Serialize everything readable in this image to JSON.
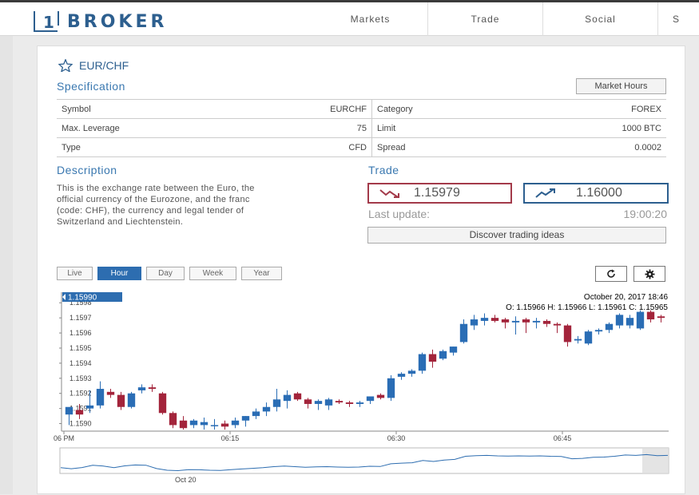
{
  "brand": {
    "logo_mark": "1",
    "name": "BROKER"
  },
  "nav": {
    "items": [
      "Markets",
      "Trade",
      "Social",
      "S"
    ]
  },
  "instrument": {
    "title": "EUR/CHF",
    "star_icon": "star-icon"
  },
  "specification": {
    "heading": "Specification",
    "market_hours_label": "Market Hours",
    "rows": [
      {
        "k1": "Symbol",
        "v1": "EURCHF",
        "k2": "Category",
        "v2": "FOREX"
      },
      {
        "k1": "Max. Leverage",
        "v1": "75",
        "k2": "Limit",
        "v2": "1000 BTC"
      },
      {
        "k1": "Type",
        "v1": "CFD",
        "k2": "Spread",
        "v2": "0.0002"
      }
    ]
  },
  "description": {
    "heading": "Description",
    "lines": [
      "This is the exchange rate between the Euro, the",
      "official currency of the Eurozone, and the franc",
      "(code: CHF), the currency and legal tender of",
      "Switzerland and Liechtenstein."
    ]
  },
  "trade": {
    "heading": "Trade",
    "sell_price": "1.15979",
    "buy_price": "1.16000",
    "last_update_label": "Last update:",
    "last_update_time": "19:00:20",
    "discover_label": "Discover trading ideas"
  },
  "chart_controls": {
    "tabs": [
      "Live",
      "Hour",
      "Day",
      "Week",
      "Year"
    ],
    "active_tab": "Hour",
    "refresh_icon": "refresh-icon",
    "settings_icon": "gear-icon"
  },
  "chart_data": {
    "type": "candlestick",
    "current_price_label": "1.15990",
    "date_label": "October 20, 2017 18:46",
    "ohlc_label": "O: 1.15966 H: 1.15966 L: 1.15961 C: 1.15965",
    "y_ticks": [
      "1.1598",
      "1.1597",
      "1.1596",
      "1.1595",
      "1.1594",
      "1.1593",
      "1.1592",
      "1.1591",
      "1.1590"
    ],
    "ylim": [
      1.15895,
      1.15987
    ],
    "x_ticks": [
      "06 PM",
      "06:15",
      "06:30",
      "06:45"
    ],
    "navigator_label": "Oct 20",
    "up_color": "#2a6db5",
    "down_color": "#a3243b",
    "candles": [
      {
        "o": 1.15906,
        "h": 1.1591,
        "l": 1.15899,
        "c": 1.15911
      },
      {
        "o": 1.15909,
        "h": 1.15913,
        "l": 1.15903,
        "c": 1.15906
      },
      {
        "o": 1.1591,
        "h": 1.15922,
        "l": 1.15907,
        "c": 1.15912
      },
      {
        "o": 1.15912,
        "h": 1.15928,
        "l": 1.1591,
        "c": 1.15923
      },
      {
        "o": 1.15921,
        "h": 1.15923,
        "l": 1.15917,
        "c": 1.15919
      },
      {
        "o": 1.15919,
        "h": 1.15921,
        "l": 1.15909,
        "c": 1.15911
      },
      {
        "o": 1.15911,
        "h": 1.15921,
        "l": 1.1591,
        "c": 1.1592
      },
      {
        "o": 1.15922,
        "h": 1.15926,
        "l": 1.1592,
        "c": 1.15924
      },
      {
        "o": 1.15924,
        "h": 1.15926,
        "l": 1.15921,
        "c": 1.15923
      },
      {
        "o": 1.1592,
        "h": 1.15921,
        "l": 1.15906,
        "c": 1.15907
      },
      {
        "o": 1.15907,
        "h": 1.15908,
        "l": 1.15897,
        "c": 1.15899
      },
      {
        "o": 1.15902,
        "h": 1.15905,
        "l": 1.15896,
        "c": 1.15897
      },
      {
        "o": 1.15899,
        "h": 1.15903,
        "l": 1.15897,
        "c": 1.15902
      },
      {
        "o": 1.15899,
        "h": 1.15904,
        "l": 1.15896,
        "c": 1.15901
      },
      {
        "o": 1.15899,
        "h": 1.15903,
        "l": 1.15896,
        "c": 1.15899
      },
      {
        "o": 1.159,
        "h": 1.15902,
        "l": 1.15896,
        "c": 1.15898
      },
      {
        "o": 1.15899,
        "h": 1.15904,
        "l": 1.15897,
        "c": 1.15902
      },
      {
        "o": 1.15902,
        "h": 1.15905,
        "l": 1.15898,
        "c": 1.15905
      },
      {
        "o": 1.15905,
        "h": 1.1591,
        "l": 1.15903,
        "c": 1.15908
      },
      {
        "o": 1.15908,
        "h": 1.15914,
        "l": 1.15905,
        "c": 1.15911
      },
      {
        "o": 1.15911,
        "h": 1.15923,
        "l": 1.15908,
        "c": 1.15916
      },
      {
        "o": 1.15915,
        "h": 1.15922,
        "l": 1.1591,
        "c": 1.15919
      },
      {
        "o": 1.1592,
        "h": 1.15921,
        "l": 1.15915,
        "c": 1.15916
      },
      {
        "o": 1.15916,
        "h": 1.15917,
        "l": 1.1591,
        "c": 1.15913
      },
      {
        "o": 1.15913,
        "h": 1.15916,
        "l": 1.15909,
        "c": 1.15915
      },
      {
        "o": 1.15912,
        "h": 1.15917,
        "l": 1.15909,
        "c": 1.15916
      },
      {
        "o": 1.15915,
        "h": 1.15916,
        "l": 1.15913,
        "c": 1.15914
      },
      {
        "o": 1.15914,
        "h": 1.15915,
        "l": 1.15911,
        "c": 1.15913
      },
      {
        "o": 1.15913,
        "h": 1.15915,
        "l": 1.15911,
        "c": 1.15914
      },
      {
        "o": 1.15915,
        "h": 1.15918,
        "l": 1.15913,
        "c": 1.15918
      },
      {
        "o": 1.15919,
        "h": 1.1592,
        "l": 1.15916,
        "c": 1.15917
      },
      {
        "o": 1.15917,
        "h": 1.15932,
        "l": 1.15915,
        "c": 1.1593
      },
      {
        "o": 1.15931,
        "h": 1.15934,
        "l": 1.15929,
        "c": 1.15933
      },
      {
        "o": 1.15933,
        "h": 1.15936,
        "l": 1.15931,
        "c": 1.15935
      },
      {
        "o": 1.15935,
        "h": 1.15947,
        "l": 1.15933,
        "c": 1.15946
      },
      {
        "o": 1.15946,
        "h": 1.15949,
        "l": 1.15937,
        "c": 1.15941
      },
      {
        "o": 1.15943,
        "h": 1.15949,
        "l": 1.15942,
        "c": 1.15948
      },
      {
        "o": 1.15947,
        "h": 1.15951,
        "l": 1.15945,
        "c": 1.15951
      },
      {
        "o": 1.15954,
        "h": 1.15969,
        "l": 1.15953,
        "c": 1.15966
      },
      {
        "o": 1.15965,
        "h": 1.15972,
        "l": 1.15962,
        "c": 1.15969
      },
      {
        "o": 1.15968,
        "h": 1.15973,
        "l": 1.15965,
        "c": 1.1597
      },
      {
        "o": 1.1597,
        "h": 1.15972,
        "l": 1.15967,
        "c": 1.15968
      },
      {
        "o": 1.15969,
        "h": 1.1597,
        "l": 1.15963,
        "c": 1.15967
      },
      {
        "o": 1.15967,
        "h": 1.15971,
        "l": 1.15959,
        "c": 1.15968
      },
      {
        "o": 1.15969,
        "h": 1.1597,
        "l": 1.1596,
        "c": 1.15967
      },
      {
        "o": 1.15967,
        "h": 1.1597,
        "l": 1.15963,
        "c": 1.15968
      },
      {
        "o": 1.15968,
        "h": 1.15969,
        "l": 1.15964,
        "c": 1.15966
      },
      {
        "o": 1.15966,
        "h": 1.15967,
        "l": 1.1596,
        "c": 1.15965
      },
      {
        "o": 1.15965,
        "h": 1.15966,
        "l": 1.15951,
        "c": 1.15954
      },
      {
        "o": 1.15955,
        "h": 1.15958,
        "l": 1.15953,
        "c": 1.15956
      },
      {
        "o": 1.15953,
        "h": 1.15962,
        "l": 1.15952,
        "c": 1.15961
      },
      {
        "o": 1.15961,
        "h": 1.15963,
        "l": 1.15959,
        "c": 1.15962
      },
      {
        "o": 1.15962,
        "h": 1.15967,
        "l": 1.1596,
        "c": 1.15966
      },
      {
        "o": 1.15965,
        "h": 1.15973,
        "l": 1.15963,
        "c": 1.15972
      },
      {
        "o": 1.15965,
        "h": 1.15972,
        "l": 1.15963,
        "c": 1.1597
      },
      {
        "o": 1.15963,
        "h": 1.15975,
        "l": 1.15962,
        "c": 1.15974
      },
      {
        "o": 1.15974,
        "h": 1.15975,
        "l": 1.15967,
        "c": 1.15969
      },
      {
        "o": 1.15971,
        "h": 1.15972,
        "l": 1.15967,
        "c": 1.1597
      }
    ]
  }
}
